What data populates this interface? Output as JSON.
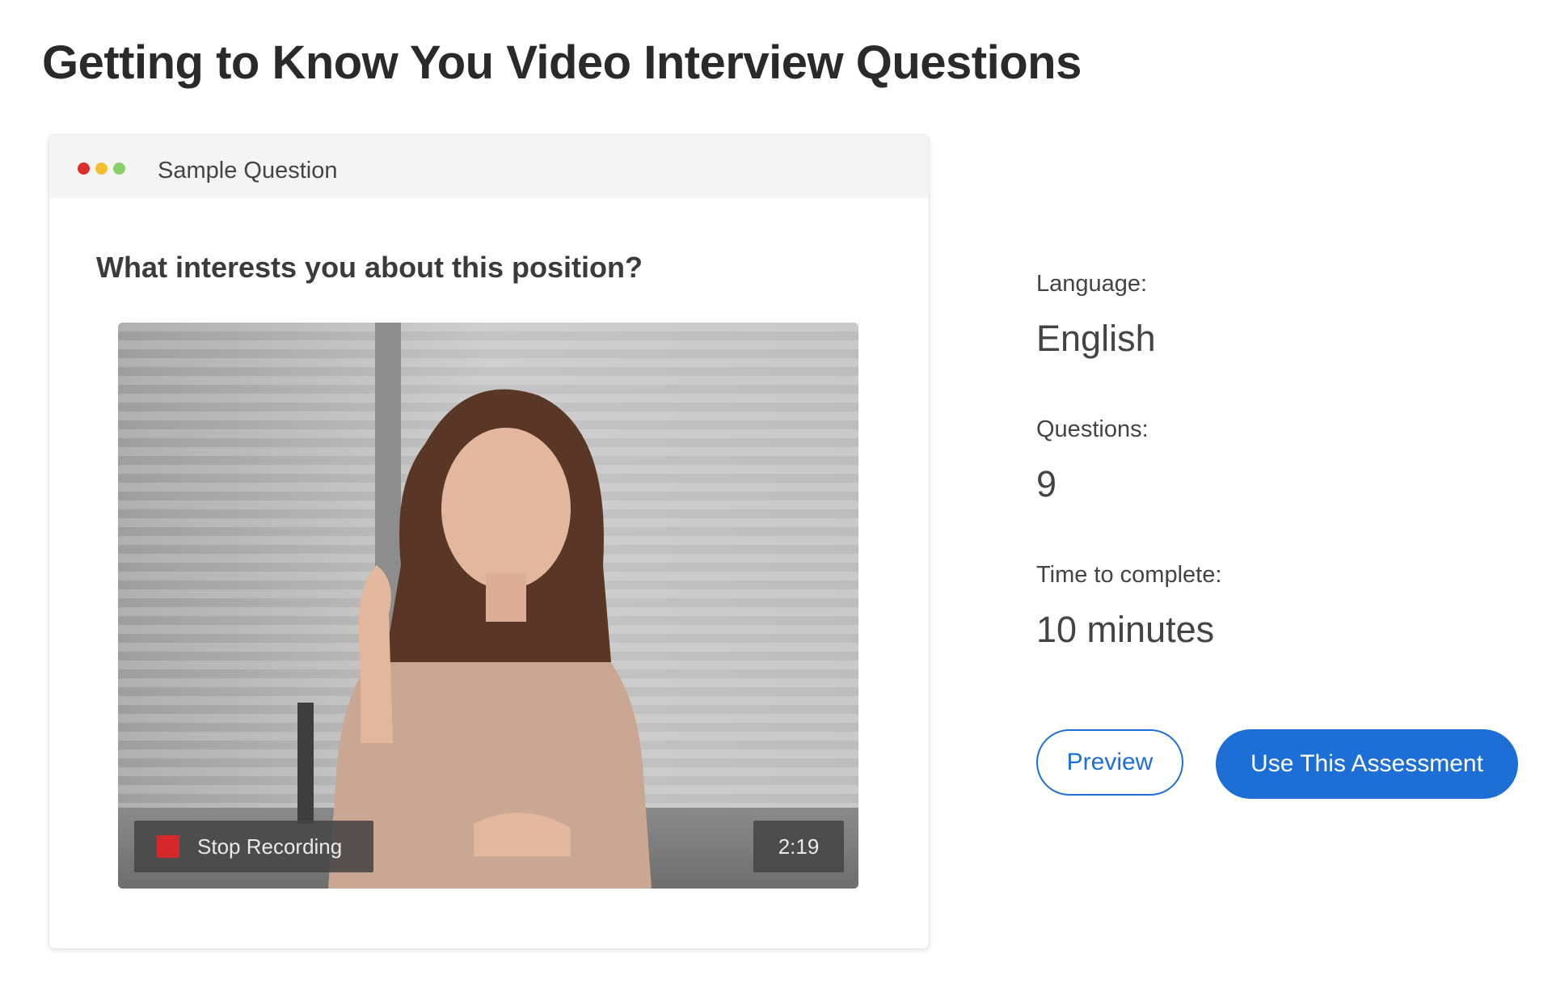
{
  "page": {
    "title": "Getting to Know You Video Interview Questions"
  },
  "sample_card": {
    "header_label": "Sample Question",
    "window_dots": [
      "red",
      "yellow",
      "green"
    ],
    "question": "What interests you about this position?",
    "video": {
      "record_button_label": "Stop Recording",
      "timer": "2:19"
    }
  },
  "details": {
    "language_label": "Language:",
    "language_value": "English",
    "questions_label": "Questions:",
    "questions_value": "9",
    "time_label": "Time to complete:",
    "time_value": "10 minutes"
  },
  "actions": {
    "preview_label": "Preview",
    "use_label": "Use This Assessment"
  },
  "colors": {
    "accent": "#1d6fd6",
    "record_red": "#d5282a",
    "dot_red": "#d9302c",
    "dot_yellow": "#f2c02f",
    "dot_green": "#8ad06a"
  }
}
